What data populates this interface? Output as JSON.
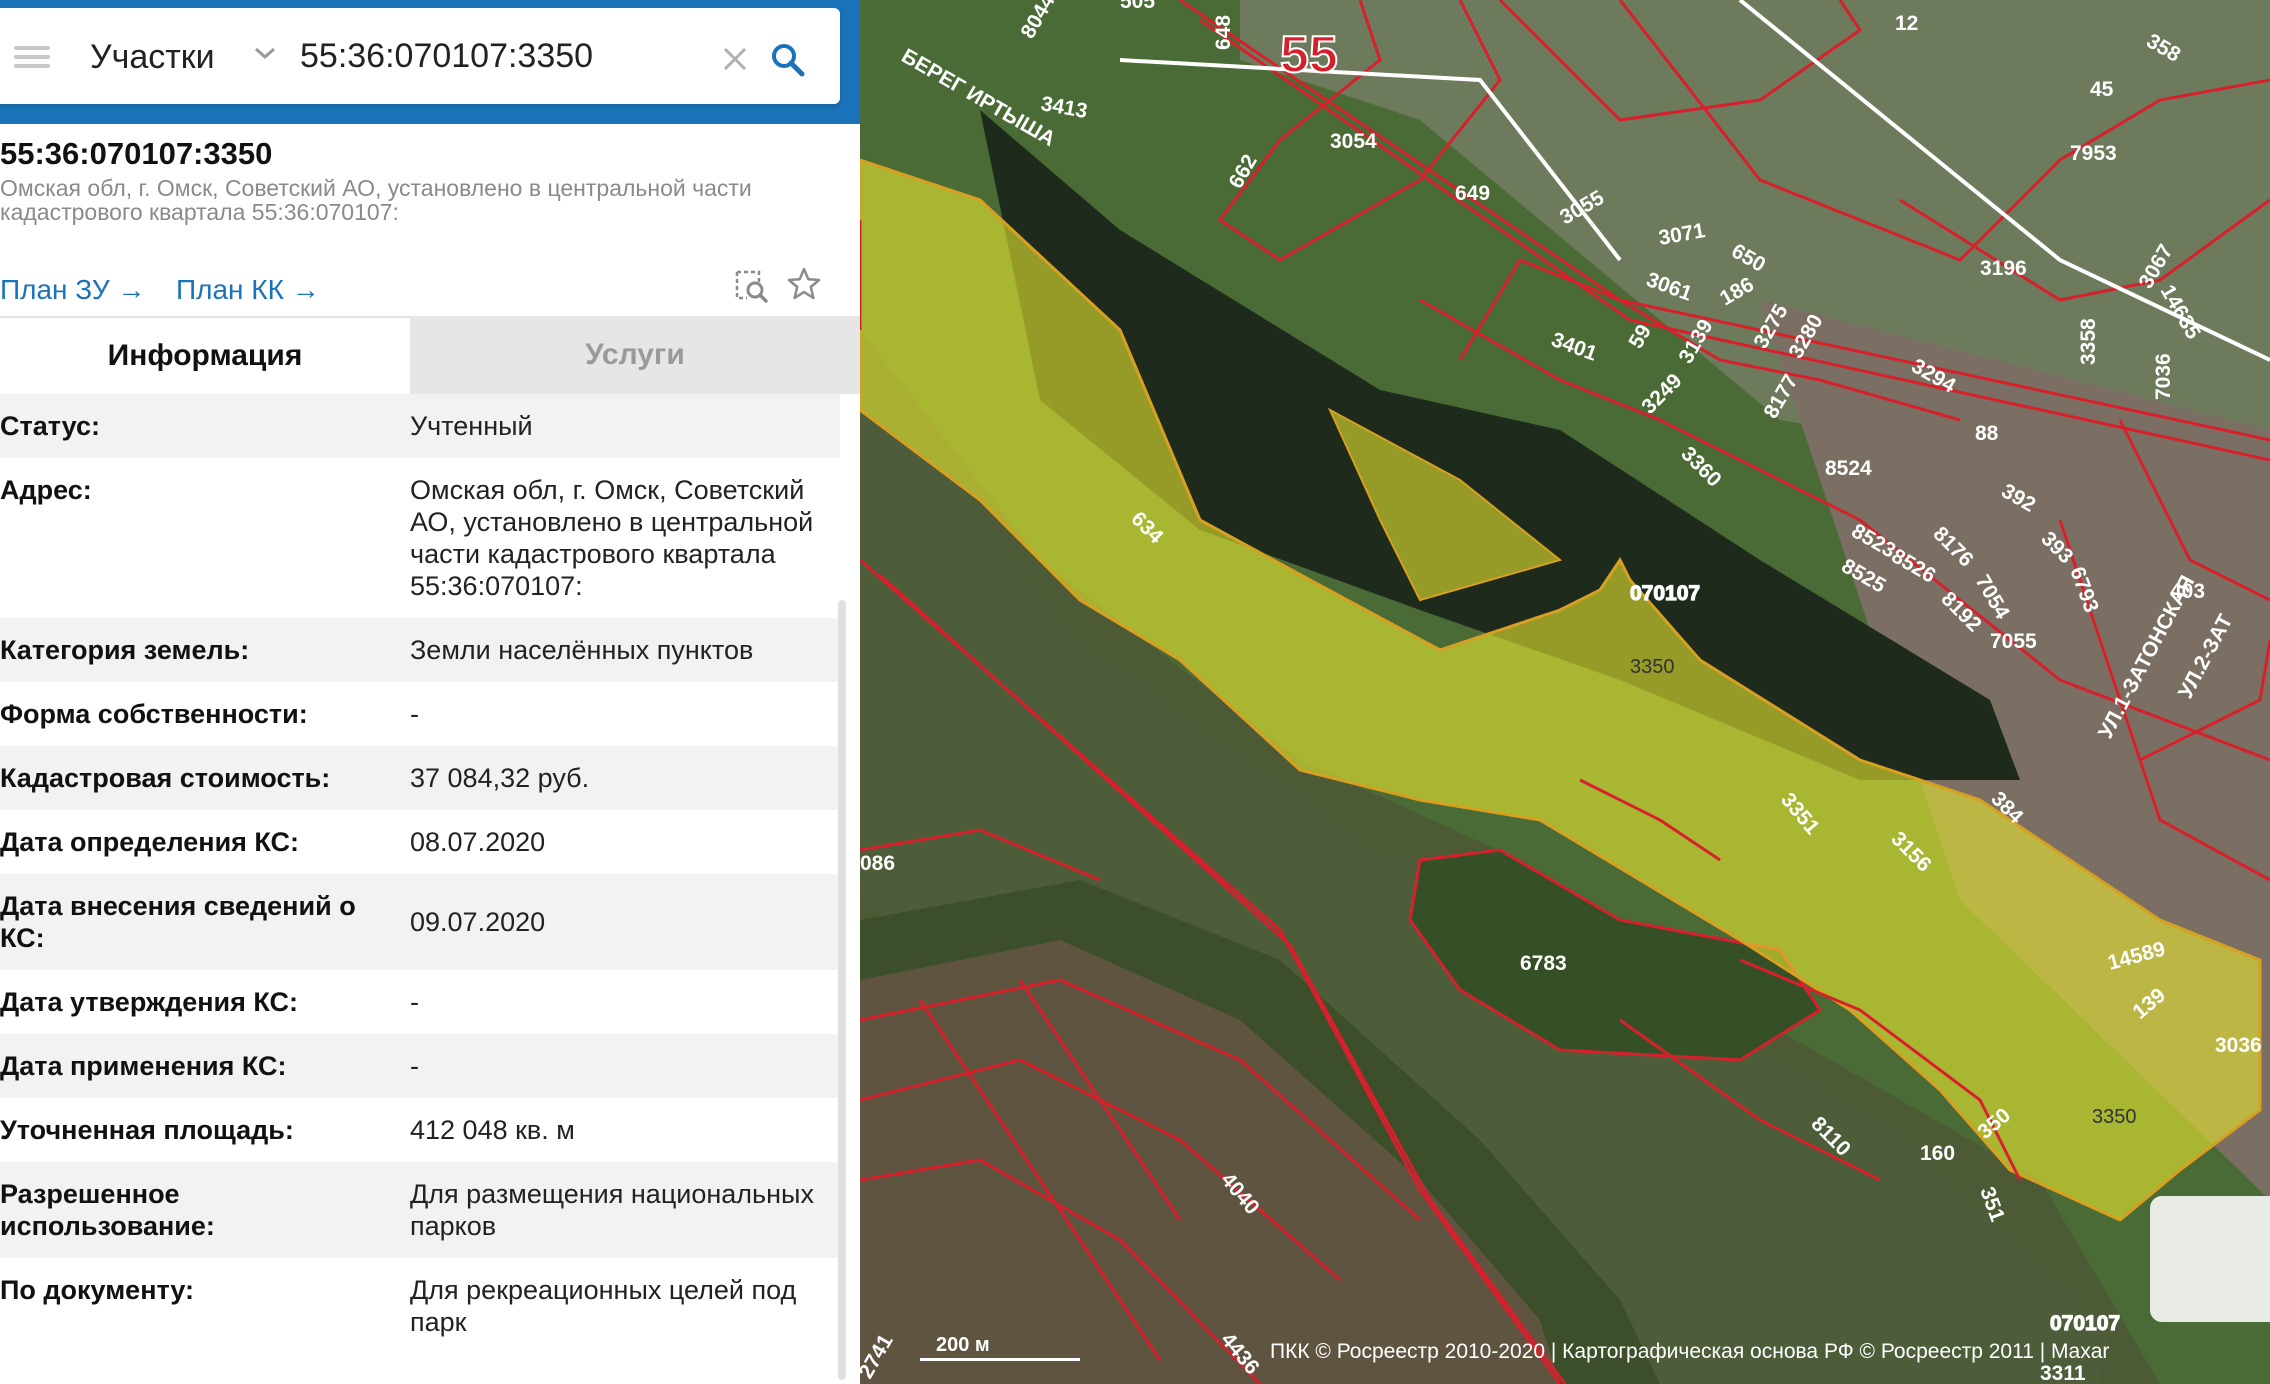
{
  "search": {
    "type_label": "Участки",
    "query": "55:36:070107:3350"
  },
  "object": {
    "title": "55:36:070107:3350",
    "address": "Омская обл, г. Омск, Советский АО, установлено в центральной части кадастрового квартала 55:36:070107:",
    "plan_zu": "План ЗУ",
    "plan_kk": "План КК"
  },
  "tabs": {
    "info": "Информация",
    "services": "Услуги"
  },
  "info_rows": [
    {
      "label": "Статус:",
      "value": "Учтенный"
    },
    {
      "label": "Адрес:",
      "value": "Омская обл, г. Омск, Советский АО, установлено в центральной части кадастрового квартала 55:36:070107:"
    },
    {
      "label": "Категория земель:",
      "value": "Земли населённых пунктов"
    },
    {
      "label": "Форма собственности:",
      "value": "-"
    },
    {
      "label": "Кадастровая стоимость:",
      "value": "37 084,32 руб."
    },
    {
      "label": "Дата определения КС:",
      "value": "08.07.2020"
    },
    {
      "label": "Дата внесения сведений о КС:",
      "value": "09.07.2020"
    },
    {
      "label": "Дата утверждения КС:",
      "value": "-"
    },
    {
      "label": "Дата применения КС:",
      "value": "-"
    },
    {
      "label": "Уточненная площадь:",
      "value": "412 048 кв. м"
    },
    {
      "label": "Разрешенное использование:",
      "value": "Для размещения национальных парков"
    },
    {
      "label": "По документу:",
      "value": "Для рекреационных целей под парк"
    }
  ],
  "map": {
    "parcel_labels": [
      "3350",
      "3350",
      "634",
      "6783",
      "3351",
      "3156",
      "384",
      "14589",
      "139",
      "3036",
      "350",
      "351",
      "160",
      "8110",
      "4040",
      "4436",
      "086",
      "2741",
      "3311",
      "8044",
      "3413",
      "662",
      "3054",
      "649",
      "3055",
      "3071",
      "3061",
      "650",
      "186",
      "3401",
      "59",
      "3139",
      "3275",
      "3280",
      "3249",
      "8177",
      "3360",
      "8524",
      "3294",
      "88",
      "392",
      "8176",
      "393",
      "8523",
      "8526",
      "8525",
      "7054",
      "6793",
      "8192",
      "7055",
      "403",
      "3196",
      "3067",
      "14635",
      "7036",
      "3358",
      "7953",
      "45",
      "358",
      "12",
      "648",
      "505"
    ],
    "quarter_labels": [
      "070107",
      "070107"
    ],
    "road_number": "55",
    "street_labels": [
      "БЕРЕГ ИРТЫША",
      "УЛ.1-ЗАТОНСКАЯ",
      "УЛ.2-ЗАТ"
    ],
    "scale": "200 м",
    "copyright": "ПКК © Росреестр 2010-2020 | Картографическая основа РФ © Росреестр 2011 | Maxar"
  },
  "colors": {
    "accent": "#1a73b8",
    "parcel_border": "#d8202c",
    "selected_fill": "#e8e830"
  }
}
